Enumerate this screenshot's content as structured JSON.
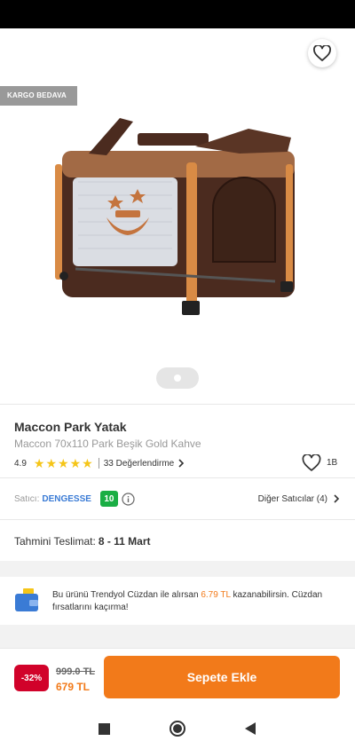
{
  "header": {
    "back_icon": "arrow-left-icon",
    "share_icon": "share-icon",
    "favorite_icon": "heart-outline-icon"
  },
  "badge": "KARGO BEDAVA",
  "gallery": {
    "pages": 1,
    "current": 1
  },
  "product": {
    "brand": "Maccon Park Yatak",
    "name": "Maccon 70x110 Park Beşik Gold Kahve",
    "rating": "4.9",
    "rating_value": 4.9,
    "reviews": "33 Değerlendirme",
    "likes": "1B"
  },
  "seller": {
    "label": "Satıcı:",
    "name": "DENGESSE",
    "score": "10",
    "others": "Diğer Satıcılar (4)"
  },
  "delivery": {
    "label": "Tahmini Teslimat:",
    "value": "8 - 11 Mart"
  },
  "wallet": {
    "text_before": "Bu ürünü Trendyol Cüzdan ile alırsan ",
    "amount": "6.79 TL",
    "text_after": " kazanabilirsin. Cüzdan fırsatlarını kaçırma!"
  },
  "price": {
    "discount": "-32%",
    "old": "999.0 TL",
    "new": "679 TL"
  },
  "actions": {
    "add_to_cart": "Sepete Ekle"
  },
  "colors": {
    "accent": "#f27a1a",
    "discount": "#d1022a",
    "seller_link": "#3a7bd5",
    "score": "#1aae44",
    "star": "#f5c518"
  }
}
